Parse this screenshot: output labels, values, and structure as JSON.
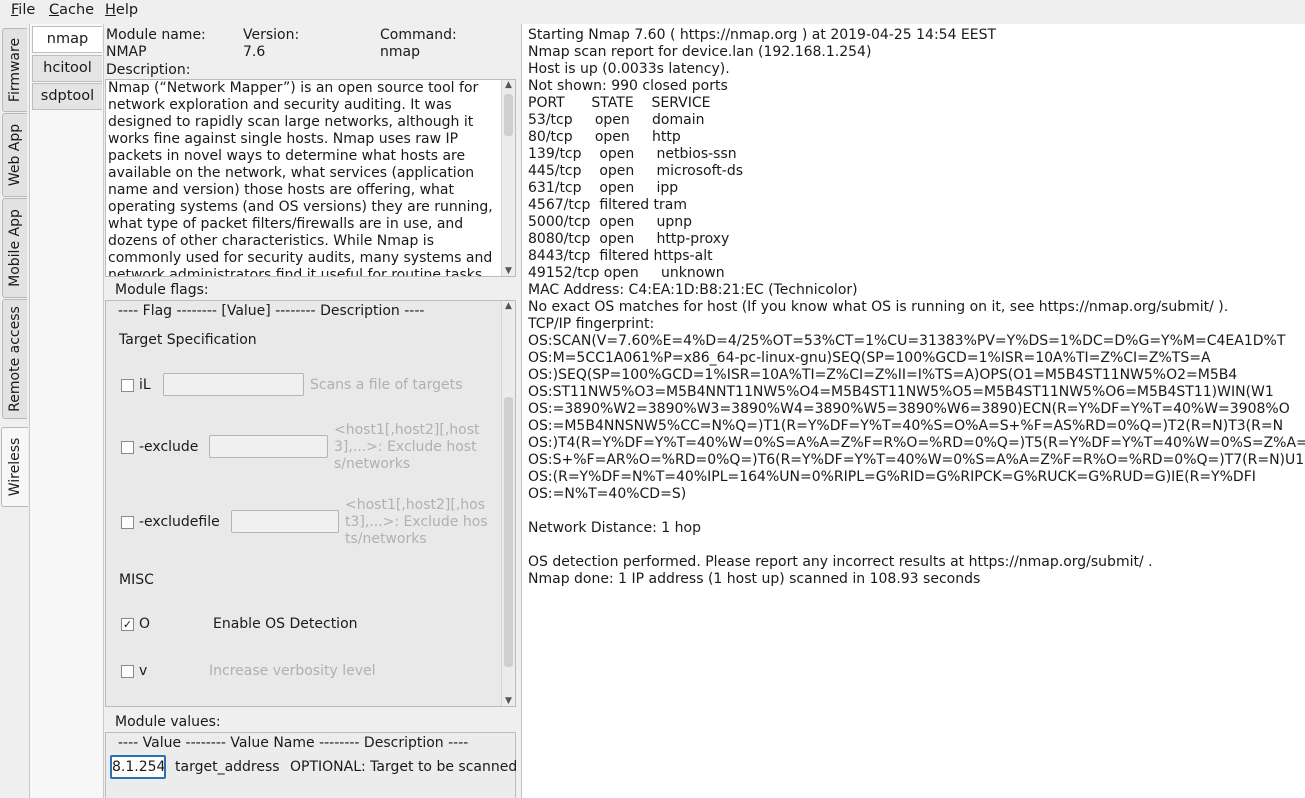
{
  "menu": [
    "File",
    "Cache",
    "Help"
  ],
  "menu_mnemonics": [
    "F",
    "C",
    "H"
  ],
  "side_tabs": [
    "Firmware",
    "Web App",
    "Mobile App",
    "Remote access",
    "Wireless"
  ],
  "module_tabs": [
    "nmap",
    "hcitool",
    "sdptool"
  ],
  "module": {
    "name_label": "Module name:",
    "name": "NMAP",
    "version_label": "Version:",
    "version": "7.6",
    "command_label": "Command:",
    "command": "nmap",
    "description_label": "Description:",
    "description": "Nmap (“Network Mapper”) is an open source tool for network exploration and security auditing. It was designed to rapidly scan large networks, although it works fine against single hosts. Nmap uses raw IP packets in novel ways to determine what hosts are available on the network, what services (application name and version) those hosts are offering, what operating systems (and OS versions) they are running, what type of packet filters/firewalls are in use, and dozens of other characteristics. While Nmap is commonly used for security audits, many systems and network administrators find it useful for routine tasks such as network inventory"
  },
  "flags": {
    "label": "Module flags:",
    "header": "---- Flag -------- [Value] -------- Description ----",
    "section_target": "Target Specification",
    "iL_flag": "iL",
    "iL_desc": "Scans a file of targets",
    "exclude_flag": "-exclude",
    "exclude_desc": "<host1[,host2][,host3],...>: Exclude hosts/networks",
    "excludefile_flag": "-excludefile",
    "excludefile_desc": "<host1[,host2][,host3],...>: Exclude hosts/networks",
    "section_misc": "MISC",
    "O_flag": "O",
    "O_desc": "Enable OS Detection",
    "O_checked": true,
    "v_flag": "v",
    "v_desc": "Increase verbosity level",
    "v_checked": false
  },
  "values": {
    "label": "Module values:",
    "header": "---- Value -------- Value Name -------- Description ----",
    "address_value": "8.1.254",
    "address_name": "target_address",
    "address_desc": "OPTIONAL: Target to be scanned"
  },
  "output": [
    "Starting Nmap 7.60 ( https://nmap.org ) at 2019-04-25 14:54 EEST",
    "Nmap scan report for device.lan (192.168.1.254)",
    "Host is up (0.0033s latency).",
    "Not shown: 990 closed ports",
    "PORT      STATE    SERVICE",
    "53/tcp     open     domain",
    "80/tcp     open     http",
    "139/tcp    open     netbios-ssn",
    "445/tcp    open     microsoft-ds",
    "631/tcp    open     ipp",
    "4567/tcp  filtered tram",
    "5000/tcp  open     upnp",
    "8080/tcp  open     http-proxy",
    "8443/tcp  filtered https-alt",
    "49152/tcp open     unknown",
    "MAC Address: C4:EA:1D:B8:21:EC (Technicolor)",
    "No exact OS matches for host (If you know what OS is running on it, see https://nmap.org/submit/ ).",
    "TCP/IP fingerprint:",
    "OS:SCAN(V=7.60%E=4%D=4/25%OT=53%CT=1%CU=31383%PV=Y%DS=1%DC=D%G=Y%M=C4EA1D%T",
    "OS:M=5CC1A061%P=x86_64-pc-linux-gnu)SEQ(SP=100%GCD=1%ISR=10A%TI=Z%CI=Z%TS=A",
    "OS:)SEQ(SP=100%GCD=1%ISR=10A%TI=Z%CI=Z%II=I%TS=A)OPS(O1=M5B4ST11NW5%O2=M5B4",
    "OS:ST11NW5%O3=M5B4NNT11NW5%O4=M5B4ST11NW5%O5=M5B4ST11NW5%O6=M5B4ST11)WIN(W1",
    "OS:=3890%W2=3890%W3=3890%W4=3890%W5=3890%W6=3890)ECN(R=Y%DF=Y%T=40%W=3908%O",
    "OS:=M5B4NNSNW5%CC=N%Q=)T1(R=Y%DF=Y%T=40%S=O%A=S+%F=AS%RD=0%Q=)T2(R=N)T3(R=N",
    "OS:)T4(R=Y%DF=Y%T=40%W=0%S=A%A=Z%F=R%O=%RD=0%Q=)T5(R=Y%DF=Y%T=40%W=0%S=Z%A=",
    "OS:S+%F=AR%O=%RD=0%Q=)T6(R=Y%DF=Y%T=40%W=0%S=A%A=Z%F=R%O=%RD=0%Q=)T7(R=N)U1",
    "OS:(R=Y%DF=N%T=40%IPL=164%UN=0%RIPL=G%RID=G%RIPCK=G%RUCK=G%RUD=G)IE(R=Y%DFI",
    "OS:=N%T=40%CD=S)",
    "",
    "Network Distance: 1 hop",
    "",
    "OS detection performed. Please report any incorrect results at https://nmap.org/submit/ .",
    "Nmap done: 1 IP address (1 host up) scanned in 108.93 seconds"
  ]
}
